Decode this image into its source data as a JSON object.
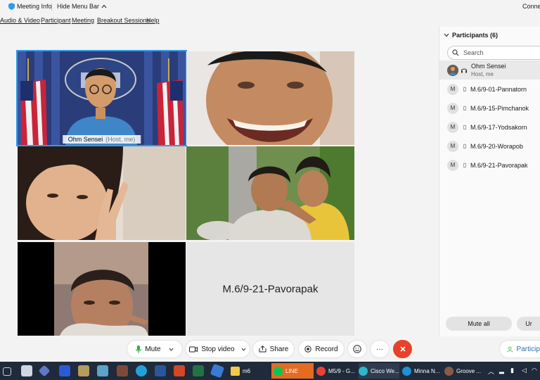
{
  "titlebar": {
    "meeting_info": "Meeting Info",
    "hide_menu_bar": "Hide Menu Bar",
    "connection": "Connec"
  },
  "menu": [
    "Audio & Video",
    "Participant",
    "Meeting",
    "Breakout Sessions",
    "Help"
  ],
  "video_tiles": {
    "host_name": "Ohm Sensei",
    "host_role": "(Host, me)",
    "placeholder_name": "M.6/9-21-Pavorapak"
  },
  "participants_panel": {
    "title": "Participants (6)",
    "search_placeholder": "Search",
    "participants": [
      {
        "initial": "",
        "name": "Ohm Sensei",
        "role": "Host, me"
      },
      {
        "initial": "M",
        "name": "M.6/9-01-Pannatorn",
        "role": ""
      },
      {
        "initial": "M",
        "name": "M.6/9-15-Pimchanok",
        "role": ""
      },
      {
        "initial": "M",
        "name": "M.6/9-17-Yodsakorn",
        "role": ""
      },
      {
        "initial": "M",
        "name": "M.6/9-20-Worapob",
        "role": ""
      },
      {
        "initial": "M",
        "name": "M.6/9-21-Pavorapak",
        "role": ""
      }
    ],
    "mute_all": "Mute all",
    "unmute_all": "Ur"
  },
  "controls": {
    "mute": "Mute",
    "stop_video": "Stop video",
    "share": "Share",
    "record": "Record",
    "more": "···",
    "participants": "Participan"
  },
  "taskbar": {
    "apps": [
      {
        "label": "m6",
        "color": "#f2c94c"
      },
      {
        "label": "LINE",
        "color": "#06c755"
      },
      {
        "label": "M5/9 - G...",
        "color": "#e94235"
      },
      {
        "label": "Cisco We...",
        "color": "#2bb8c8"
      },
      {
        "label": "Minna N...",
        "color": "#1e90d6"
      },
      {
        "label": "Groove ...",
        "color": "#8a5a44"
      }
    ]
  },
  "colors": {
    "accent_blue": "#2f9be8",
    "end_red": "#e8412c",
    "mic_green": "#2ea84a"
  }
}
